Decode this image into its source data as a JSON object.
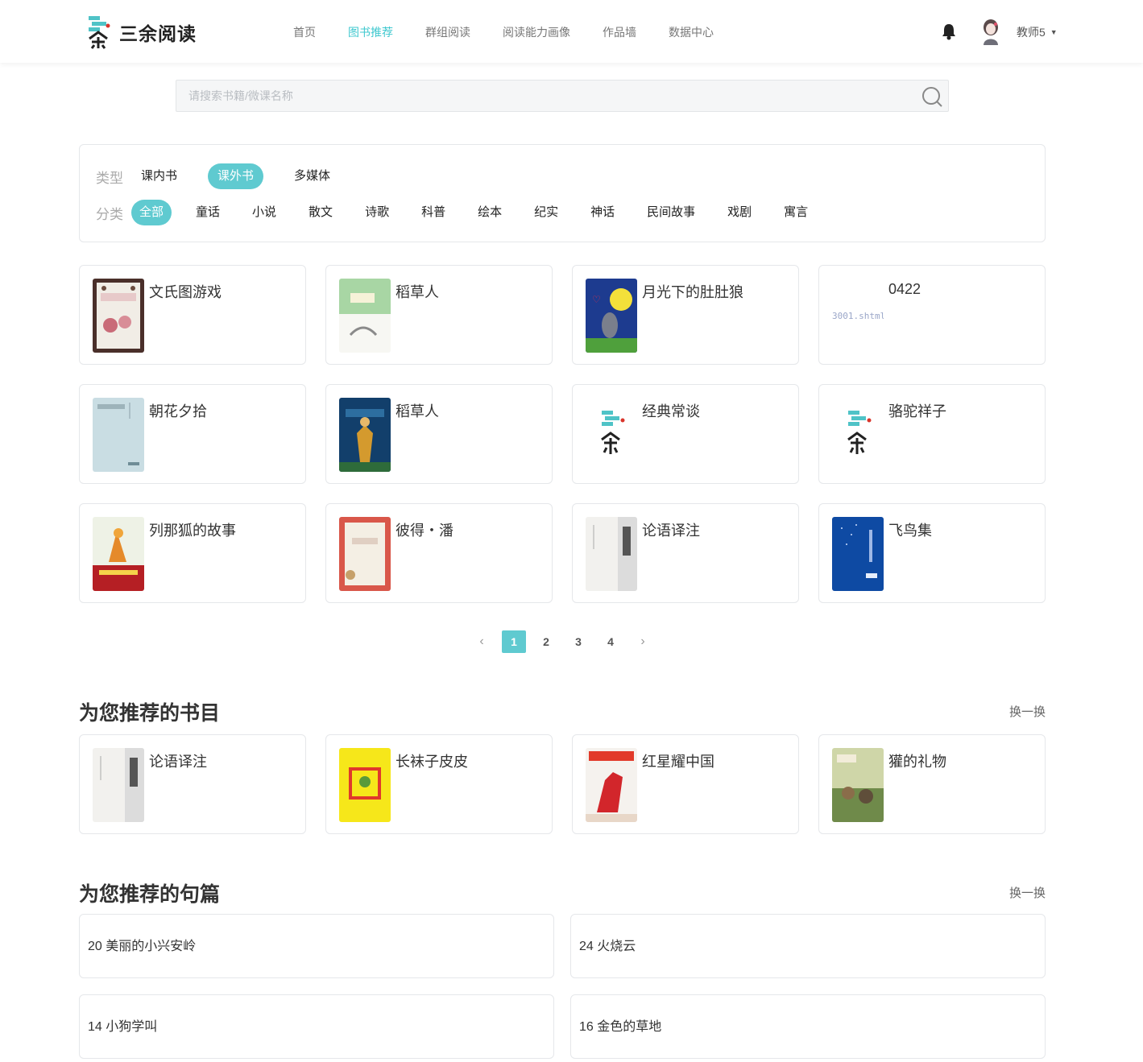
{
  "header": {
    "logo_text": "三余阅读",
    "nav": [
      {
        "label": "首页",
        "active": false
      },
      {
        "label": "图书推荐",
        "active": true
      },
      {
        "label": "群组阅读",
        "active": false
      },
      {
        "label": "阅读能力画像",
        "active": false
      },
      {
        "label": "作品墙",
        "active": false
      },
      {
        "label": "数据中心",
        "active": false
      }
    ],
    "user_name": "教师5",
    "user_caret": "▼"
  },
  "search": {
    "placeholder": "请搜索书籍/微课名称"
  },
  "filter": {
    "type_label": "类型",
    "types": [
      {
        "label": "课内书",
        "active": false
      },
      {
        "label": "课外书",
        "active": true
      },
      {
        "label": "多媒体",
        "active": false
      }
    ],
    "category_label": "分类",
    "categories": [
      {
        "label": "全部",
        "active": true
      },
      {
        "label": "童话",
        "active": false
      },
      {
        "label": "小说",
        "active": false
      },
      {
        "label": "散文",
        "active": false
      },
      {
        "label": "诗歌",
        "active": false
      },
      {
        "label": "科普",
        "active": false
      },
      {
        "label": "绘本",
        "active": false
      },
      {
        "label": "纪实",
        "active": false
      },
      {
        "label": "神话",
        "active": false
      },
      {
        "label": "民间故事",
        "active": false
      },
      {
        "label": "戏剧",
        "active": false
      },
      {
        "label": "寓言",
        "active": false
      }
    ]
  },
  "books": [
    {
      "title": "文氏图游戏",
      "cover": "illustrated-dark"
    },
    {
      "title": "稻草人",
      "cover": "green-light"
    },
    {
      "title": "月光下的肚肚狼",
      "cover": "blue-moon"
    },
    {
      "title": "0422",
      "cover": "broken-text"
    },
    {
      "title": "朝花夕拾",
      "cover": "pale-blue"
    },
    {
      "title": "稻草人",
      "cover": "dark-blue"
    },
    {
      "title": "经典常谈",
      "cover": "placeholder-logo"
    },
    {
      "title": "骆驼祥子",
      "cover": "placeholder-logo"
    },
    {
      "title": "列那狐的故事",
      "cover": "fox-red"
    },
    {
      "title": "彼得・潘",
      "cover": "red-pattern"
    },
    {
      "title": "论语译注",
      "cover": "white-classic"
    },
    {
      "title": "飞鸟集",
      "cover": "deep-blue"
    }
  ],
  "broken_cover_text": "3001.shtml\"/>",
  "pagination": {
    "prev": "‹",
    "pages": [
      "1",
      "2",
      "3",
      "4"
    ],
    "active": "1",
    "next": "›"
  },
  "rec_books": {
    "title": "为您推荐的书目",
    "swap": "换一换",
    "items": [
      {
        "title": "论语译注",
        "cover": "white-classic"
      },
      {
        "title": "长袜子皮皮",
        "cover": "yellow"
      },
      {
        "title": "红星耀中国",
        "cover": "red-star"
      },
      {
        "title": "獾的礼物",
        "cover": "forest"
      }
    ]
  },
  "rec_quotes": {
    "title": "为您推荐的句篇",
    "swap": "换一换",
    "items": [
      "20 美丽的小兴安岭",
      "24 火烧云",
      "14 小狗学叫",
      "16 金色的草地"
    ]
  },
  "colors": {
    "accent": "#5fcad0",
    "nav_active": "#3fc8cf"
  }
}
